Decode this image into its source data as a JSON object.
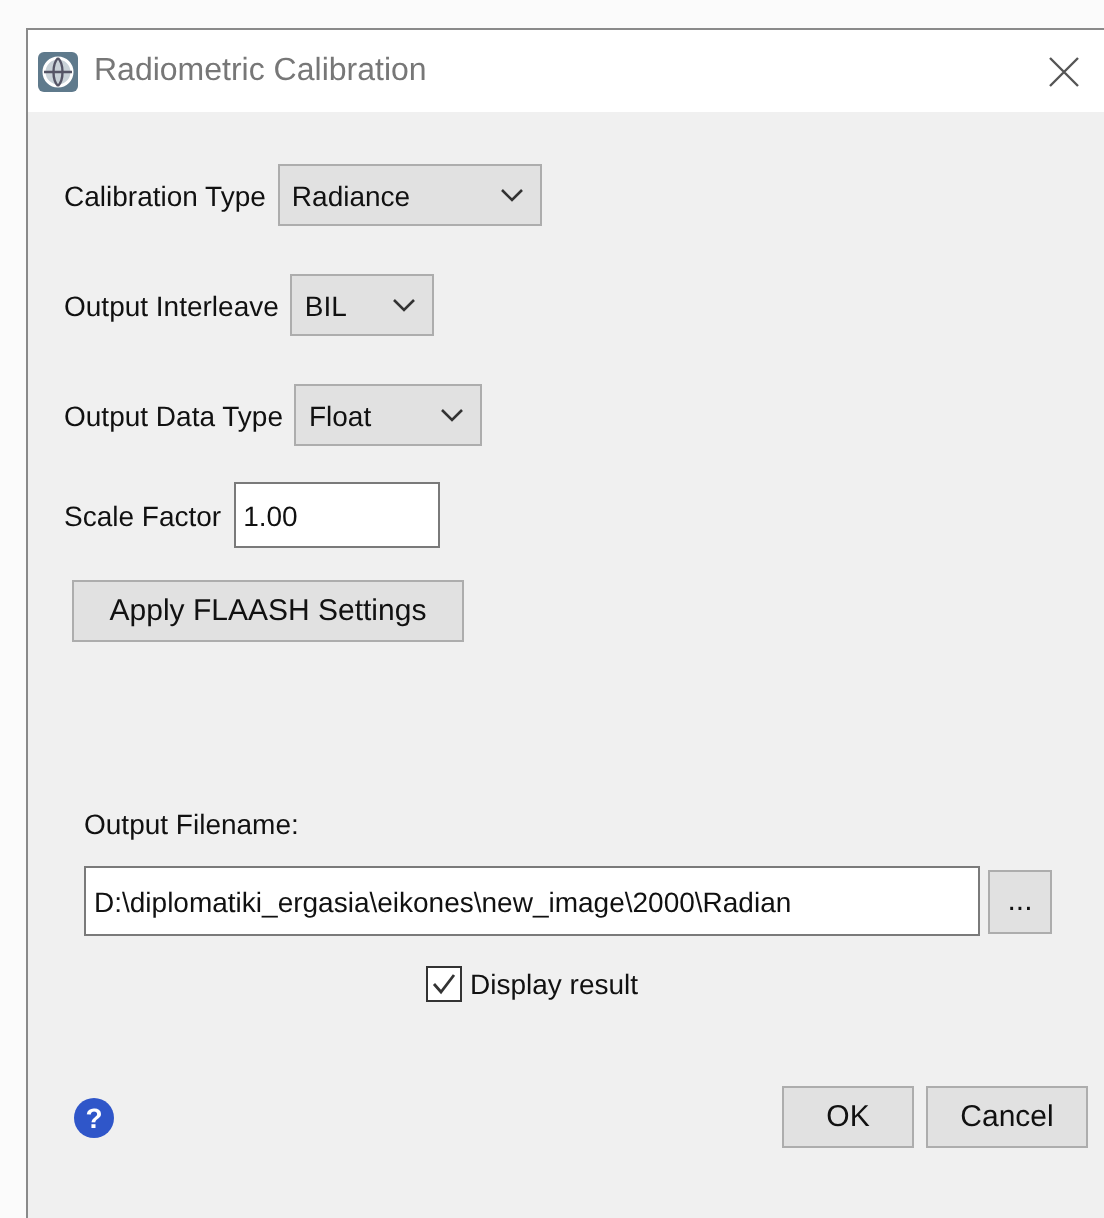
{
  "window": {
    "title": "Radiometric Calibration"
  },
  "fields": [
    {
      "kind": "dropdown",
      "label": "Calibration Type",
      "value": "Radiance"
    },
    {
      "kind": "dropdown",
      "label": "Output Interleave",
      "value": "BIL"
    },
    {
      "kind": "dropdown",
      "label": "Output Data Type",
      "value": "Float"
    },
    {
      "kind": "text",
      "label": "Scale Factor",
      "value": "1.00"
    }
  ],
  "apply_button": "Apply FLAASH Settings",
  "output": {
    "label": "Output Filename:",
    "value": "D:\\diplomatiki_ergasia\\eikones\\new_image\\2000\\Radian",
    "browse": "..."
  },
  "display_result": {
    "label": "Display result",
    "checked": true
  },
  "help": "?",
  "buttons": [
    "OK",
    "Cancel"
  ]
}
